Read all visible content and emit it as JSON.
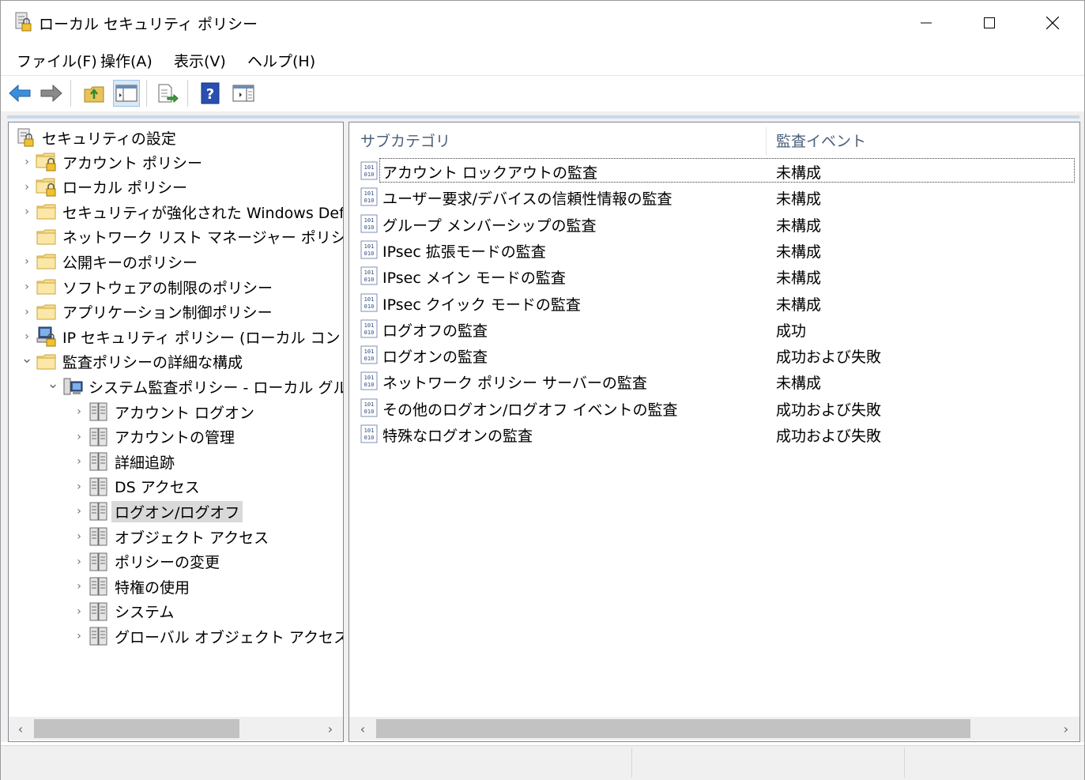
{
  "window": {
    "title": "ローカル セキュリティ ポリシー",
    "icon": "security-policy-icon",
    "controls": [
      "minimize-icon",
      "maximize-icon",
      "close-icon"
    ]
  },
  "menu": [
    "ファイル(F)",
    "操作(A)",
    "表示(V)",
    "ヘルプ(H)"
  ],
  "toolbar": {
    "buttons": [
      "back-arrow-icon",
      "forward-arrow-icon",
      "up-folder-icon",
      "show-hide-tree-icon",
      "export-list-icon",
      "help-icon",
      "show-hide-action-pane-icon"
    ]
  },
  "tree": {
    "root": "セキュリティの設定",
    "items": [
      {
        "label": "アカウント ポリシー",
        "expander": "›"
      },
      {
        "label": "ローカル ポリシー",
        "expander": "›"
      },
      {
        "label": "セキュリティが強化された Windows Defen",
        "expander": "›"
      },
      {
        "label": "ネットワーク リスト マネージャー ポリシー",
        "expander": ""
      },
      {
        "label": "公開キーのポリシー",
        "expander": "›"
      },
      {
        "label": "ソフトウェアの制限のポリシー",
        "expander": "›"
      },
      {
        "label": "アプリケーション制御ポリシー",
        "expander": "›"
      },
      {
        "label": "IP セキュリティ ポリシー (ローカル コンピューター",
        "expander": "›"
      },
      {
        "label": "監査ポリシーの詳細な構成",
        "expander": "⌄"
      },
      {
        "label": "システム監査ポリシー - ローカル グループ",
        "expander": "⌄"
      },
      {
        "label": "アカウント ログオン",
        "expander": "›"
      },
      {
        "label": "アカウントの管理",
        "expander": "›"
      },
      {
        "label": "詳細追跡",
        "expander": "›"
      },
      {
        "label": "DS アクセス",
        "expander": "›"
      },
      {
        "label": "ログオン/ログオフ",
        "expander": "›"
      },
      {
        "label": "オブジェクト アクセス",
        "expander": "›"
      },
      {
        "label": "ポリシーの変更",
        "expander": "›"
      },
      {
        "label": "特権の使用",
        "expander": "›"
      },
      {
        "label": "システム",
        "expander": "›"
      },
      {
        "label": "グローバル オブジェクト アクセスの監",
        "expander": "›"
      }
    ],
    "selected": "ログオン/ログオフ"
  },
  "list": {
    "columns": [
      "サブカテゴリ",
      "監査イベント"
    ],
    "rows": [
      {
        "subcategory": "アカウント ロックアウトの監査",
        "event": "未構成"
      },
      {
        "subcategory": "ユーザー要求/デバイスの信頼性情報の監査",
        "event": "未構成"
      },
      {
        "subcategory": "グループ メンバーシップの監査",
        "event": "未構成"
      },
      {
        "subcategory": "IPsec 拡張モードの監査",
        "event": "未構成"
      },
      {
        "subcategory": "IPsec メイン モードの監査",
        "event": "未構成"
      },
      {
        "subcategory": "IPsec クイック モードの監査",
        "event": "未構成"
      },
      {
        "subcategory": "ログオフの監査",
        "event": "成功"
      },
      {
        "subcategory": "ログオンの監査",
        "event": "成功および失敗"
      },
      {
        "subcategory": "ネットワーク ポリシー サーバーの監査",
        "event": "未構成"
      },
      {
        "subcategory": "その他のログオン/ログオフ イベントの監査",
        "event": "成功および失敗"
      },
      {
        "subcategory": "特殊なログオンの監査",
        "event": "成功および失敗"
      }
    ]
  },
  "scrollbars": {
    "left_arrow": "‹",
    "right_arrow": "›"
  }
}
